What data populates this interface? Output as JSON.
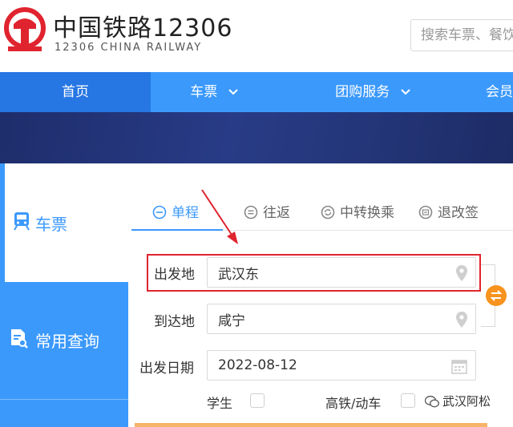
{
  "header": {
    "logo_cn": "中国铁路12306",
    "logo_en": "12306 CHINA RAILWAY",
    "search_placeholder": "搜索车票、餐饮"
  },
  "nav": {
    "items": [
      {
        "label": "首页",
        "dropdown": false,
        "active": true
      },
      {
        "label": "车票",
        "dropdown": true,
        "active": false
      },
      {
        "label": "团购服务",
        "dropdown": true,
        "active": false
      },
      {
        "label": "会员",
        "dropdown": false,
        "active": false
      }
    ]
  },
  "side_tabs": [
    {
      "label": "车票",
      "icon": "train-icon",
      "active": true
    },
    {
      "label": "常用查询",
      "icon": "document-search-icon",
      "active": false
    }
  ],
  "trip_tabs": [
    {
      "label": "单程",
      "icon": "minus-circle-icon",
      "active": true
    },
    {
      "label": "往返",
      "icon": "equals-circle-icon",
      "active": false
    },
    {
      "label": "中转换乘",
      "icon": "transfer-circle-icon",
      "active": false
    },
    {
      "label": "退改签",
      "icon": "ticket-circle-icon",
      "active": false
    }
  ],
  "form": {
    "from_label": "出发地",
    "from_value": "武汉东",
    "to_label": "到达地",
    "to_value": "咸宁",
    "date_label": "出发日期",
    "date_value": "2022-08-12",
    "student_label": "学生",
    "highspeed_label": "高铁/动车"
  },
  "watermark": "武汉阿松",
  "colors": {
    "primary": "#3b99fc",
    "nav_active": "#2676e3",
    "annotation": "#e0242f",
    "swap": "#f7931e",
    "logo_red": "#e0242f"
  }
}
